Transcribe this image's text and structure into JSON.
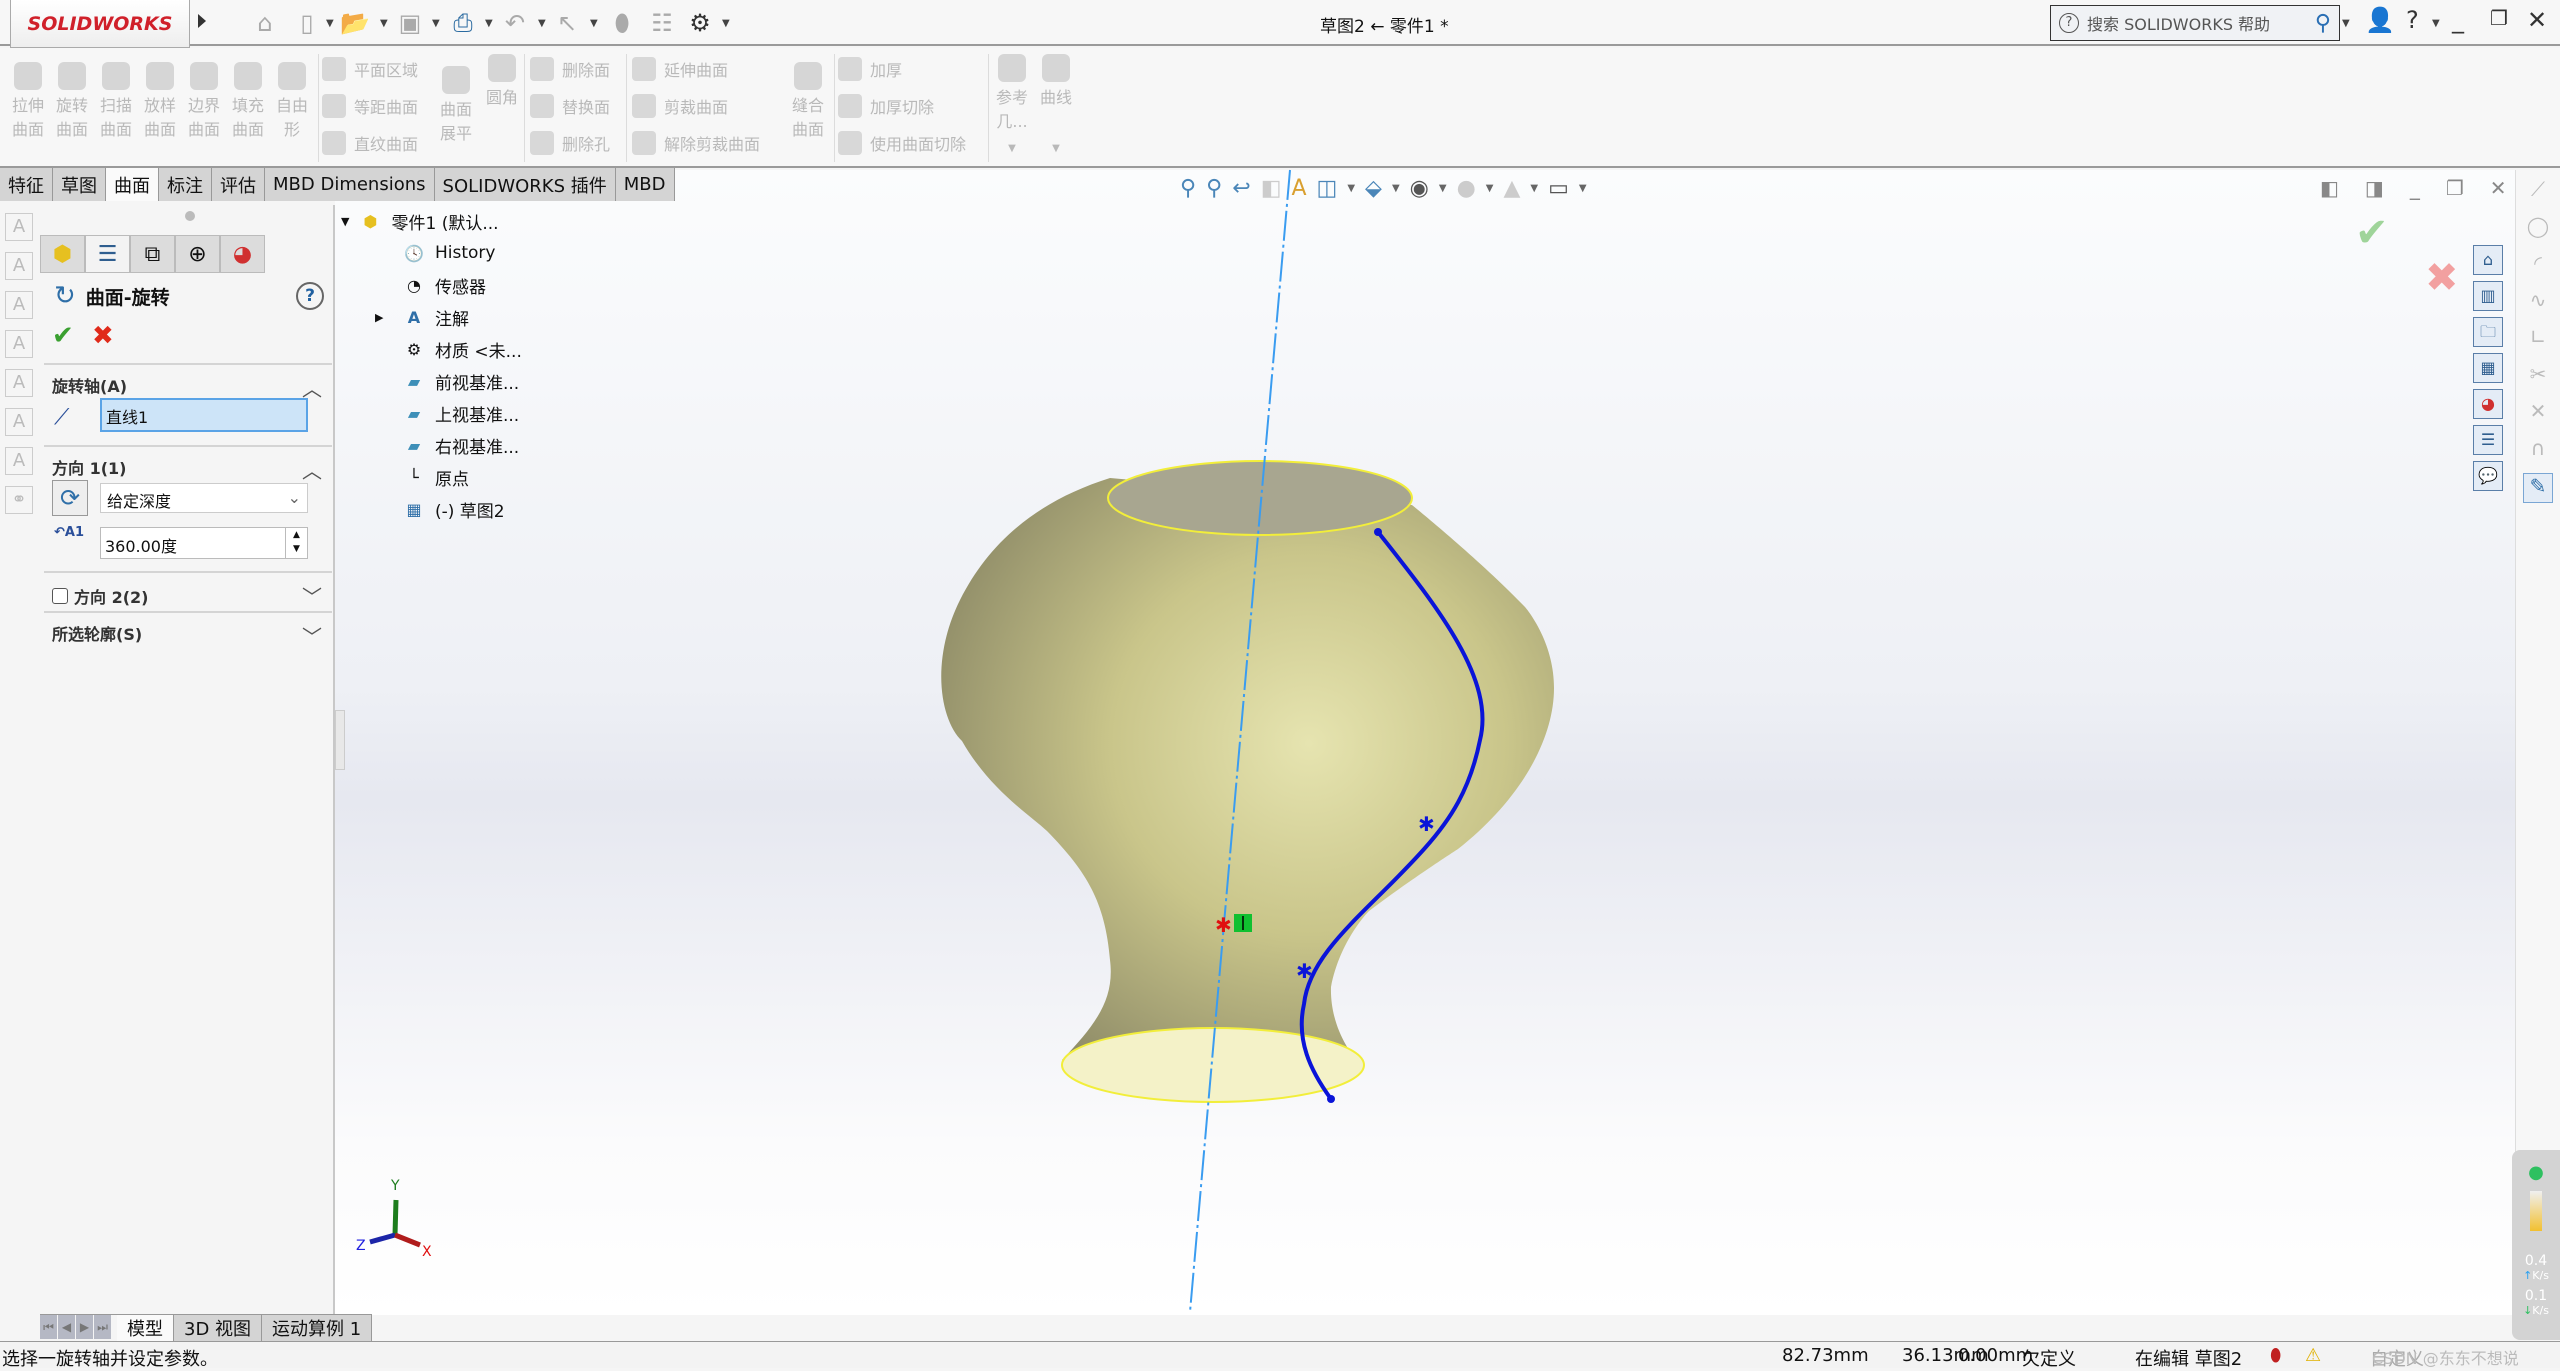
{
  "app": {
    "logo": "SOLIDWORKS",
    "document_title": "草图2 ← 零件1 *"
  },
  "titlebar": {
    "quick_access_icons": [
      "home-icon",
      "new-icon",
      "open-icon",
      "save-icon",
      "print-icon",
      "undo-icon",
      "select-icon",
      "rebuild-icon",
      "file-properties-icon",
      "options-gear-icon"
    ],
    "search_placeholder": "搜索 SOLIDWORKS 帮助",
    "help_label": "?"
  },
  "ribbon": {
    "big_buttons": [
      {
        "line1": "拉伸",
        "line2": "曲面"
      },
      {
        "line1": "旋转",
        "line2": "曲面"
      },
      {
        "line1": "扫描",
        "line2": "曲面"
      },
      {
        "line1": "放样",
        "line2": "曲面"
      },
      {
        "line1": "边界",
        "line2": "曲面"
      },
      {
        "line1": "填充",
        "line2": "曲面"
      },
      {
        "line1": "自由",
        "line2": "形"
      }
    ],
    "group2": [
      "平面区域",
      "等距曲面",
      "直纹曲面"
    ],
    "flatten": {
      "line1": "曲面",
      "line2": "展平"
    },
    "fillet": "圆角",
    "group3": [
      "删除面",
      "替换面",
      "删除孔"
    ],
    "group4": [
      "延伸曲面",
      "剪裁曲面",
      "解除剪裁曲面"
    ],
    "knit": {
      "line1": "缝合",
      "line2": "曲面"
    },
    "group5": [
      "加厚",
      "加厚切除",
      "使用曲面切除"
    ],
    "reference": {
      "line1": "参考",
      "line2": "几..."
    },
    "curves": "曲线"
  },
  "tabs": [
    {
      "label": "特征"
    },
    {
      "label": "草图"
    },
    {
      "label": "曲面",
      "active": true
    },
    {
      "label": "标注"
    },
    {
      "label": "评估"
    },
    {
      "label": "MBD Dimensions"
    },
    {
      "label": "SOLIDWORKS 插件"
    },
    {
      "label": "MBD"
    }
  ],
  "property_manager": {
    "title": "曲面-旋转",
    "help": "?",
    "axis_section": "旋转轴(A)",
    "axis_value": "直线1",
    "direction1_section": "方向 1(1)",
    "end_condition": "给定深度",
    "angle": "360.00度",
    "angle_icon_label": "A1",
    "direction2_section": "方向 2(2)",
    "direction2_checked": false,
    "contours_section": "所选轮廓(S)"
  },
  "feature_tree": {
    "root": "零件1 (默认...",
    "items": [
      "History",
      "传感器",
      "注解",
      "材质 <未...",
      "前视基准...",
      "上视基准...",
      "右视基准...",
      "原点",
      "(-) 草图2"
    ]
  },
  "triad": {
    "x": "X",
    "y": "Y",
    "z": "Z"
  },
  "bottom_tabs": [
    {
      "label": "模型",
      "active": true
    },
    {
      "label": "3D 视图"
    },
    {
      "label": "运动算例 1"
    }
  ],
  "status": {
    "message": "选择一旋转轴并设定参数。",
    "x": "82.73mm",
    "y": "36.13mm",
    "z": "0.00mm",
    "definition": "欠定义",
    "editing": "在编辑 草图2",
    "custom": "自定义"
  },
  "network_widget": {
    "up": "0.4",
    "up_unit": "K/s",
    "down": "0.1",
    "down_unit": "K/s"
  },
  "watermark": "CSDN @东东不想说",
  "colors": {
    "surface": "#c9c58a",
    "sketch_curve": "#0a14d8",
    "axis": "#3a9cf0",
    "edge": "#f2ee3a"
  }
}
